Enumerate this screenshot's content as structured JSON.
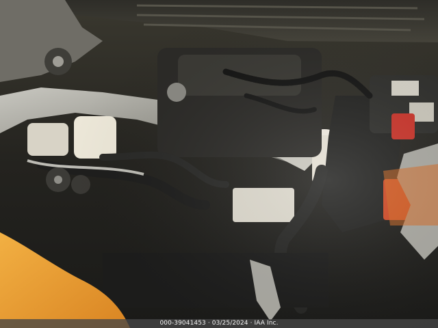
{
  "photo": {
    "subject": "engine-bay",
    "palette": {
      "background": "#1a1a18",
      "hood_underside": "#3d3b33",
      "metal_silver": "#b9b9b2",
      "hose_black": "#222221",
      "coolant_reservoir": "#e9e4d5",
      "battery_cover": "#2a2a28",
      "red_accent": "#c8342a",
      "orange_foreground": "#e79a2a"
    }
  },
  "watermark": {
    "text": "000-39041453 · 03/25/2024 · IAA Inc."
  }
}
